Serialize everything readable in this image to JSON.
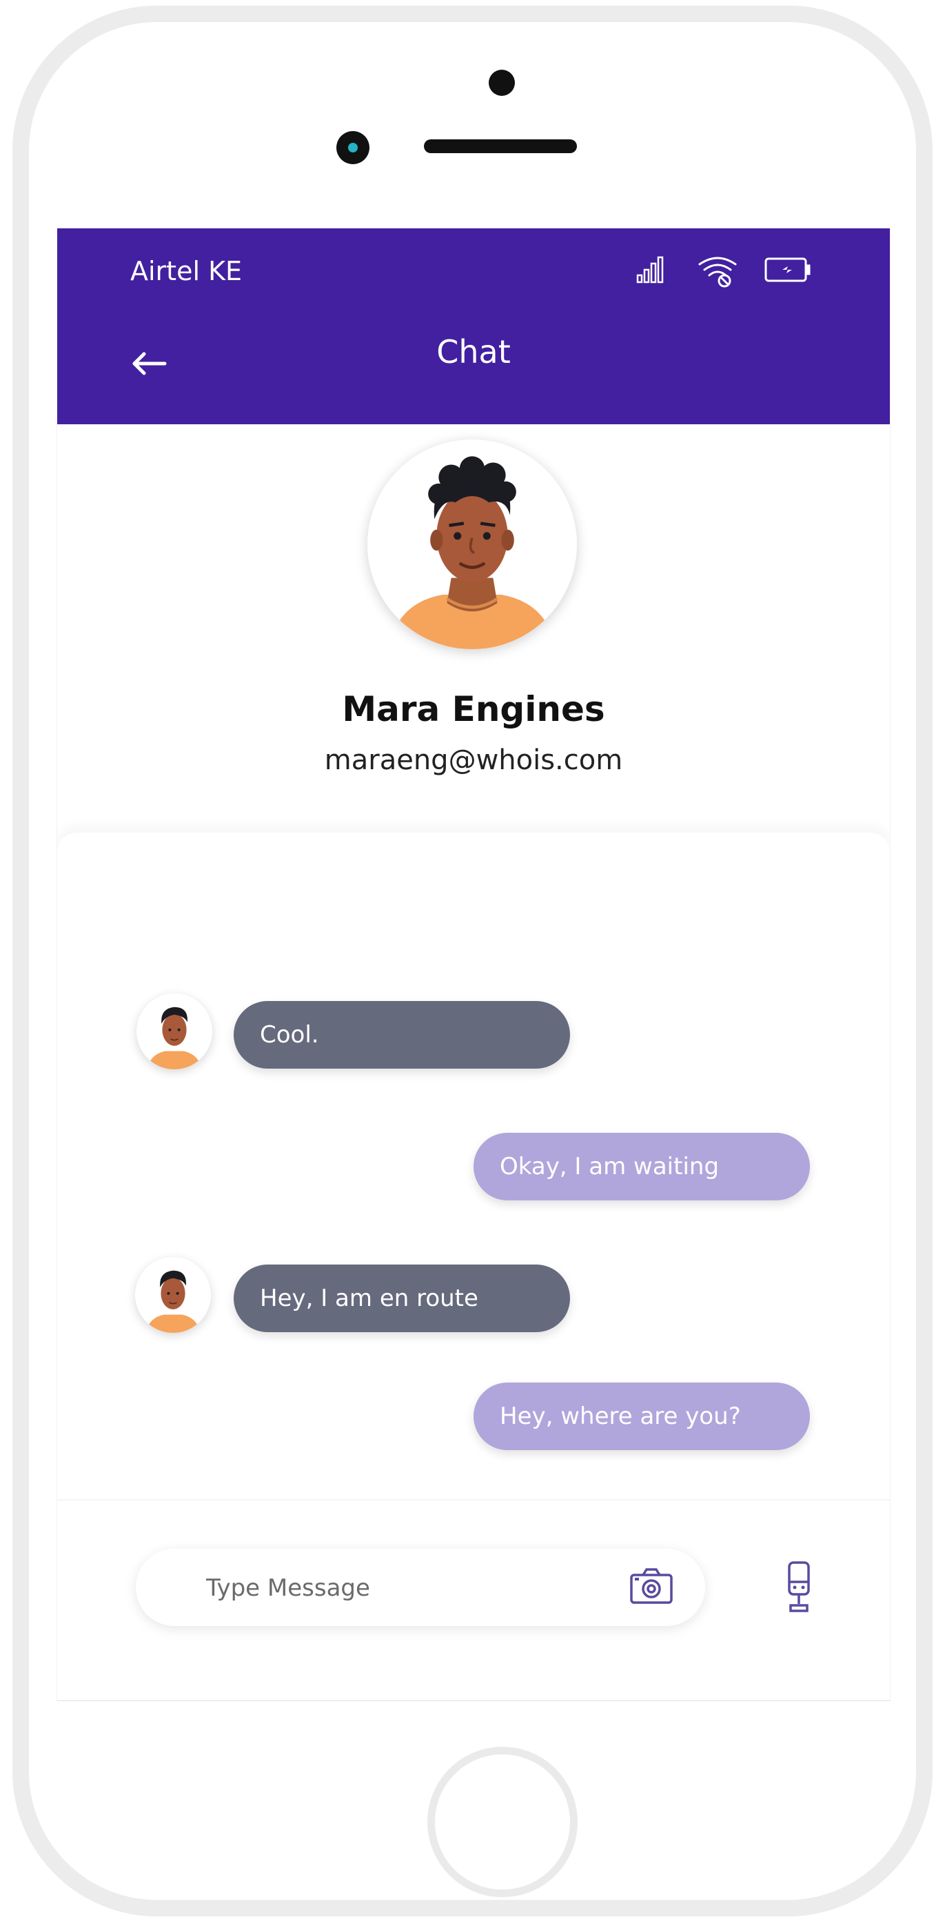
{
  "status_bar": {
    "carrier": "Airtel KE",
    "icons": [
      "signal-icon",
      "wifi-icon",
      "battery-charging-icon"
    ]
  },
  "header": {
    "back_icon": "arrow-left-icon",
    "title": "Chat"
  },
  "profile": {
    "name": "Mara Engines",
    "email": "maraeng@whois.com",
    "avatar": "avatar-illustration"
  },
  "messages": [
    {
      "direction": "received",
      "text": "Cool."
    },
    {
      "direction": "sent",
      "text": "Okay, I am waiting"
    },
    {
      "direction": "received",
      "text": "Hey, I am en route"
    },
    {
      "direction": "sent",
      "text": "Hey, where are you?"
    }
  ],
  "composer": {
    "placeholder": "Type Message",
    "camera_icon": "camera-icon",
    "mic_icon": "microphone-icon"
  },
  "colors": {
    "accent": "#4220a0",
    "received_bubble": "#666a7d",
    "sent_bubble": "#b1a6db"
  }
}
